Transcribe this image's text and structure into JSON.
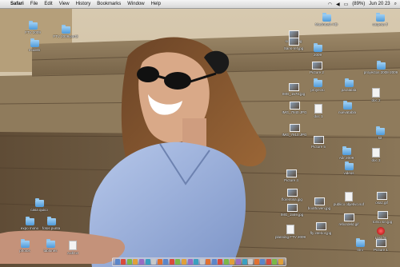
{
  "menubar": {
    "app": "Safari",
    "items": [
      "File",
      "Edit",
      "View",
      "History",
      "Bookmarks",
      "Window",
      "Help"
    ],
    "battery": "(89%)",
    "clock": "Jun 20 23"
  },
  "desktop": {
    "left": [
      "FTV 2009",
      "models",
      "FTV 2009.part2",
      "casa quico",
      "expo mono",
      "fotos punta",
      "photos",
      "tablones",
      "zxdl.txt"
    ],
    "right": [
      "Macintosh HD",
      "carpeta tf",
      "screen.jpg",
      "Sans-ref.jpg",
      "Picture 2",
      "IMG_1578.jpg",
      "IMG_7940.JPG",
      "IMG_7910.JPG",
      "Picture 5",
      "Picture 4",
      "IMG_1559.jpg",
      "planning FTV 2009",
      "florentina.jpg",
      "fly interior.jpg",
      "publico objetivo.sof",
      "trini",
      "Picture 1",
      "proyectos 2008-2009",
      "2009",
      "paratabla",
      "nuevatabla",
      "kit",
      "boothoven.jpg",
      "rebordeld.gif",
      "osaz.gif",
      "torso sin.jpg",
      "Last.fm",
      "Abr 2009",
      "videos",
      "doc 1",
      "doc 2",
      "proyecto",
      "doc 3"
    ]
  },
  "dock_count": 28
}
